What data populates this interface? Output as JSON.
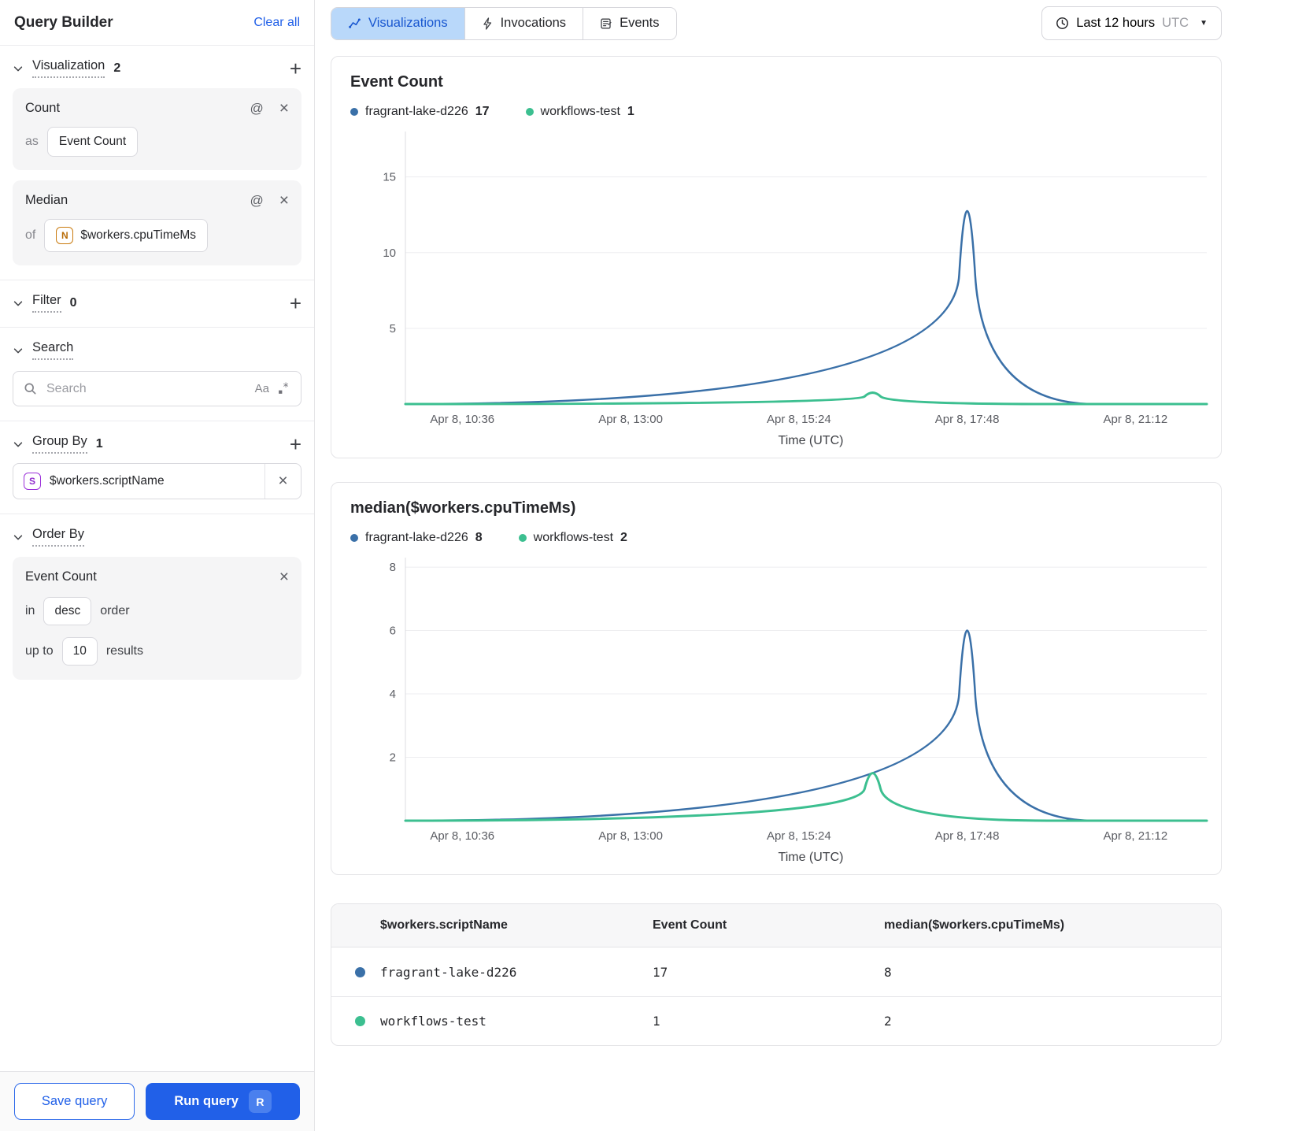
{
  "sidebar": {
    "title": "Query Builder",
    "clear_all_label": "Clear all",
    "visualization_section": {
      "label": "Visualization",
      "count": "2"
    },
    "count_card": {
      "title": "Count",
      "prefix": "as",
      "alias": "Event Count"
    },
    "median_card": {
      "title": "Median",
      "prefix": "of",
      "field_badge": "N",
      "field": "$workers.cpuTimeMs"
    },
    "filter_section": {
      "label": "Filter",
      "count": "0"
    },
    "search_section": {
      "label": "Search",
      "placeholder": "Search",
      "match_case_glyph": "Aa"
    },
    "group_by_section": {
      "label": "Group By",
      "count": "1",
      "item_badge": "S",
      "item": "$workers.scriptName"
    },
    "order_by_section": {
      "label": "Order By"
    },
    "order_card": {
      "field": "Event Count",
      "in_label": "in",
      "direction": "desc",
      "order_label": "order",
      "up_to_label": "up to",
      "limit": "10",
      "results_label": "results"
    },
    "save_query_label": "Save query",
    "run_query_label": "Run query",
    "run_query_shortcut": "R"
  },
  "topbar": {
    "tabs": [
      {
        "label": "Visualizations",
        "active": true
      },
      {
        "label": "Invocations",
        "active": false
      },
      {
        "label": "Events",
        "active": false
      }
    ],
    "time_range": {
      "label": "Last 12 hours",
      "timezone": "UTC"
    }
  },
  "glyphs": {
    "close": "×",
    "plus": "+",
    "at": "@",
    "caret": "▼"
  },
  "colors": {
    "series_blue": "#3a70a8",
    "series_green": "#3cbf90",
    "accent_blue": "#2160e8",
    "active_tab_bg": "#b9d8fa",
    "active_tab_text": "#1957d0"
  },
  "chart_data": [
    {
      "type": "line",
      "title": "Event Count",
      "xlabel": "Time (UTC)",
      "x_tick_labels": [
        "Apr 8, 10:36",
        "Apr 8, 13:00",
        "Apr 8, 15:24",
        "Apr 8, 17:48",
        "Apr 8, 21:12"
      ],
      "x_tick_positions": [
        0.071,
        0.281,
        0.491,
        0.701,
        0.911
      ],
      "y_ticks": [
        5,
        10,
        15
      ],
      "ylim": [
        0,
        18
      ],
      "grid": true,
      "legend_position": "top",
      "series": [
        {
          "name": "fragrant-lake-d226",
          "color": "#3a70a8",
          "legend_value": "17",
          "points": [
            [
              0,
              0
            ],
            [
              0.681,
              0
            ],
            [
              0.701,
              17
            ],
            [
              0.721,
              0
            ],
            [
              1,
              0
            ]
          ]
        },
        {
          "name": "workflows-test",
          "color": "#3cbf90",
          "legend_value": "1",
          "points": [
            [
              0,
              0
            ],
            [
              0.563,
              0
            ],
            [
              0.583,
              1
            ],
            [
              0.603,
              0
            ],
            [
              1,
              0
            ]
          ]
        }
      ]
    },
    {
      "type": "line",
      "title": "median($workers.cpuTimeMs)",
      "xlabel": "Time (UTC)",
      "x_tick_labels": [
        "Apr 8, 10:36",
        "Apr 8, 13:00",
        "Apr 8, 15:24",
        "Apr 8, 17:48",
        "Apr 8, 21:12"
      ],
      "x_tick_positions": [
        0.071,
        0.281,
        0.491,
        0.701,
        0.911
      ],
      "y_ticks": [
        2,
        4,
        6,
        8
      ],
      "ylim": [
        0,
        8.3
      ],
      "grid": true,
      "legend_position": "top",
      "series": [
        {
          "name": "fragrant-lake-d226",
          "color": "#3a70a8",
          "legend_value": "8",
          "points": [
            [
              0,
              0
            ],
            [
              0.681,
              0
            ],
            [
              0.701,
              8
            ],
            [
              0.721,
              0
            ],
            [
              1,
              0
            ]
          ]
        },
        {
          "name": "workflows-test",
          "color": "#3cbf90",
          "legend_value": "2",
          "points": [
            [
              0,
              0
            ],
            [
              0.563,
              0
            ],
            [
              0.583,
              2
            ],
            [
              0.603,
              0
            ],
            [
              1,
              0
            ]
          ]
        }
      ]
    }
  ],
  "table": {
    "columns": [
      "$workers.scriptName",
      "Event Count",
      "median($workers.cpuTimeMs)"
    ],
    "rows": [
      {
        "dot_color": "#3a70a8",
        "script_name": "fragrant-lake-d226",
        "event_count": "17",
        "median": "8"
      },
      {
        "dot_color": "#3cbf90",
        "script_name": "workflows-test",
        "event_count": "1",
        "median": "2"
      }
    ]
  }
}
